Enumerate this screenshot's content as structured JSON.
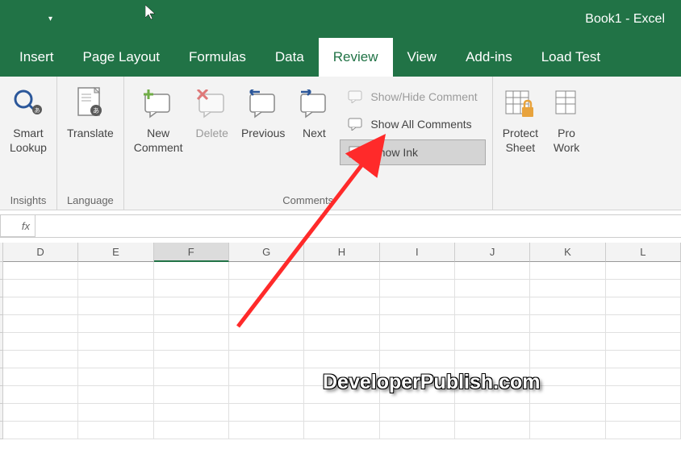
{
  "titlebar": {
    "title": "Book1  -  Excel",
    "qat_dropdown": "▾"
  },
  "tabs": {
    "insert": "Insert",
    "page_layout": "Page Layout",
    "formulas": "Formulas",
    "data": "Data",
    "review": "Review",
    "view": "View",
    "addins": "Add-ins",
    "load_test": "Load Test"
  },
  "ribbon": {
    "insights": {
      "smart_lookup": "Smart\nLookup",
      "group_label": "Insights"
    },
    "language": {
      "translate": "Translate",
      "group_label": "Language"
    },
    "comments": {
      "new_comment": "New\nComment",
      "delete": "Delete",
      "previous": "Previous",
      "next": "Next",
      "show_hide": "Show/Hide Comment",
      "show_all": "Show All Comments",
      "show_ink": "Show Ink",
      "group_label": "Comments"
    },
    "protect": {
      "protect_sheet": "Protect\nSheet",
      "protect_workbook": "Pro\nWork"
    }
  },
  "formula_bar": {
    "fx": "fx",
    "value": ""
  },
  "columns": [
    "D",
    "E",
    "F",
    "G",
    "H",
    "I",
    "J",
    "K",
    "L"
  ],
  "selected_column": "F",
  "watermark": "DeveloperPublish.com"
}
